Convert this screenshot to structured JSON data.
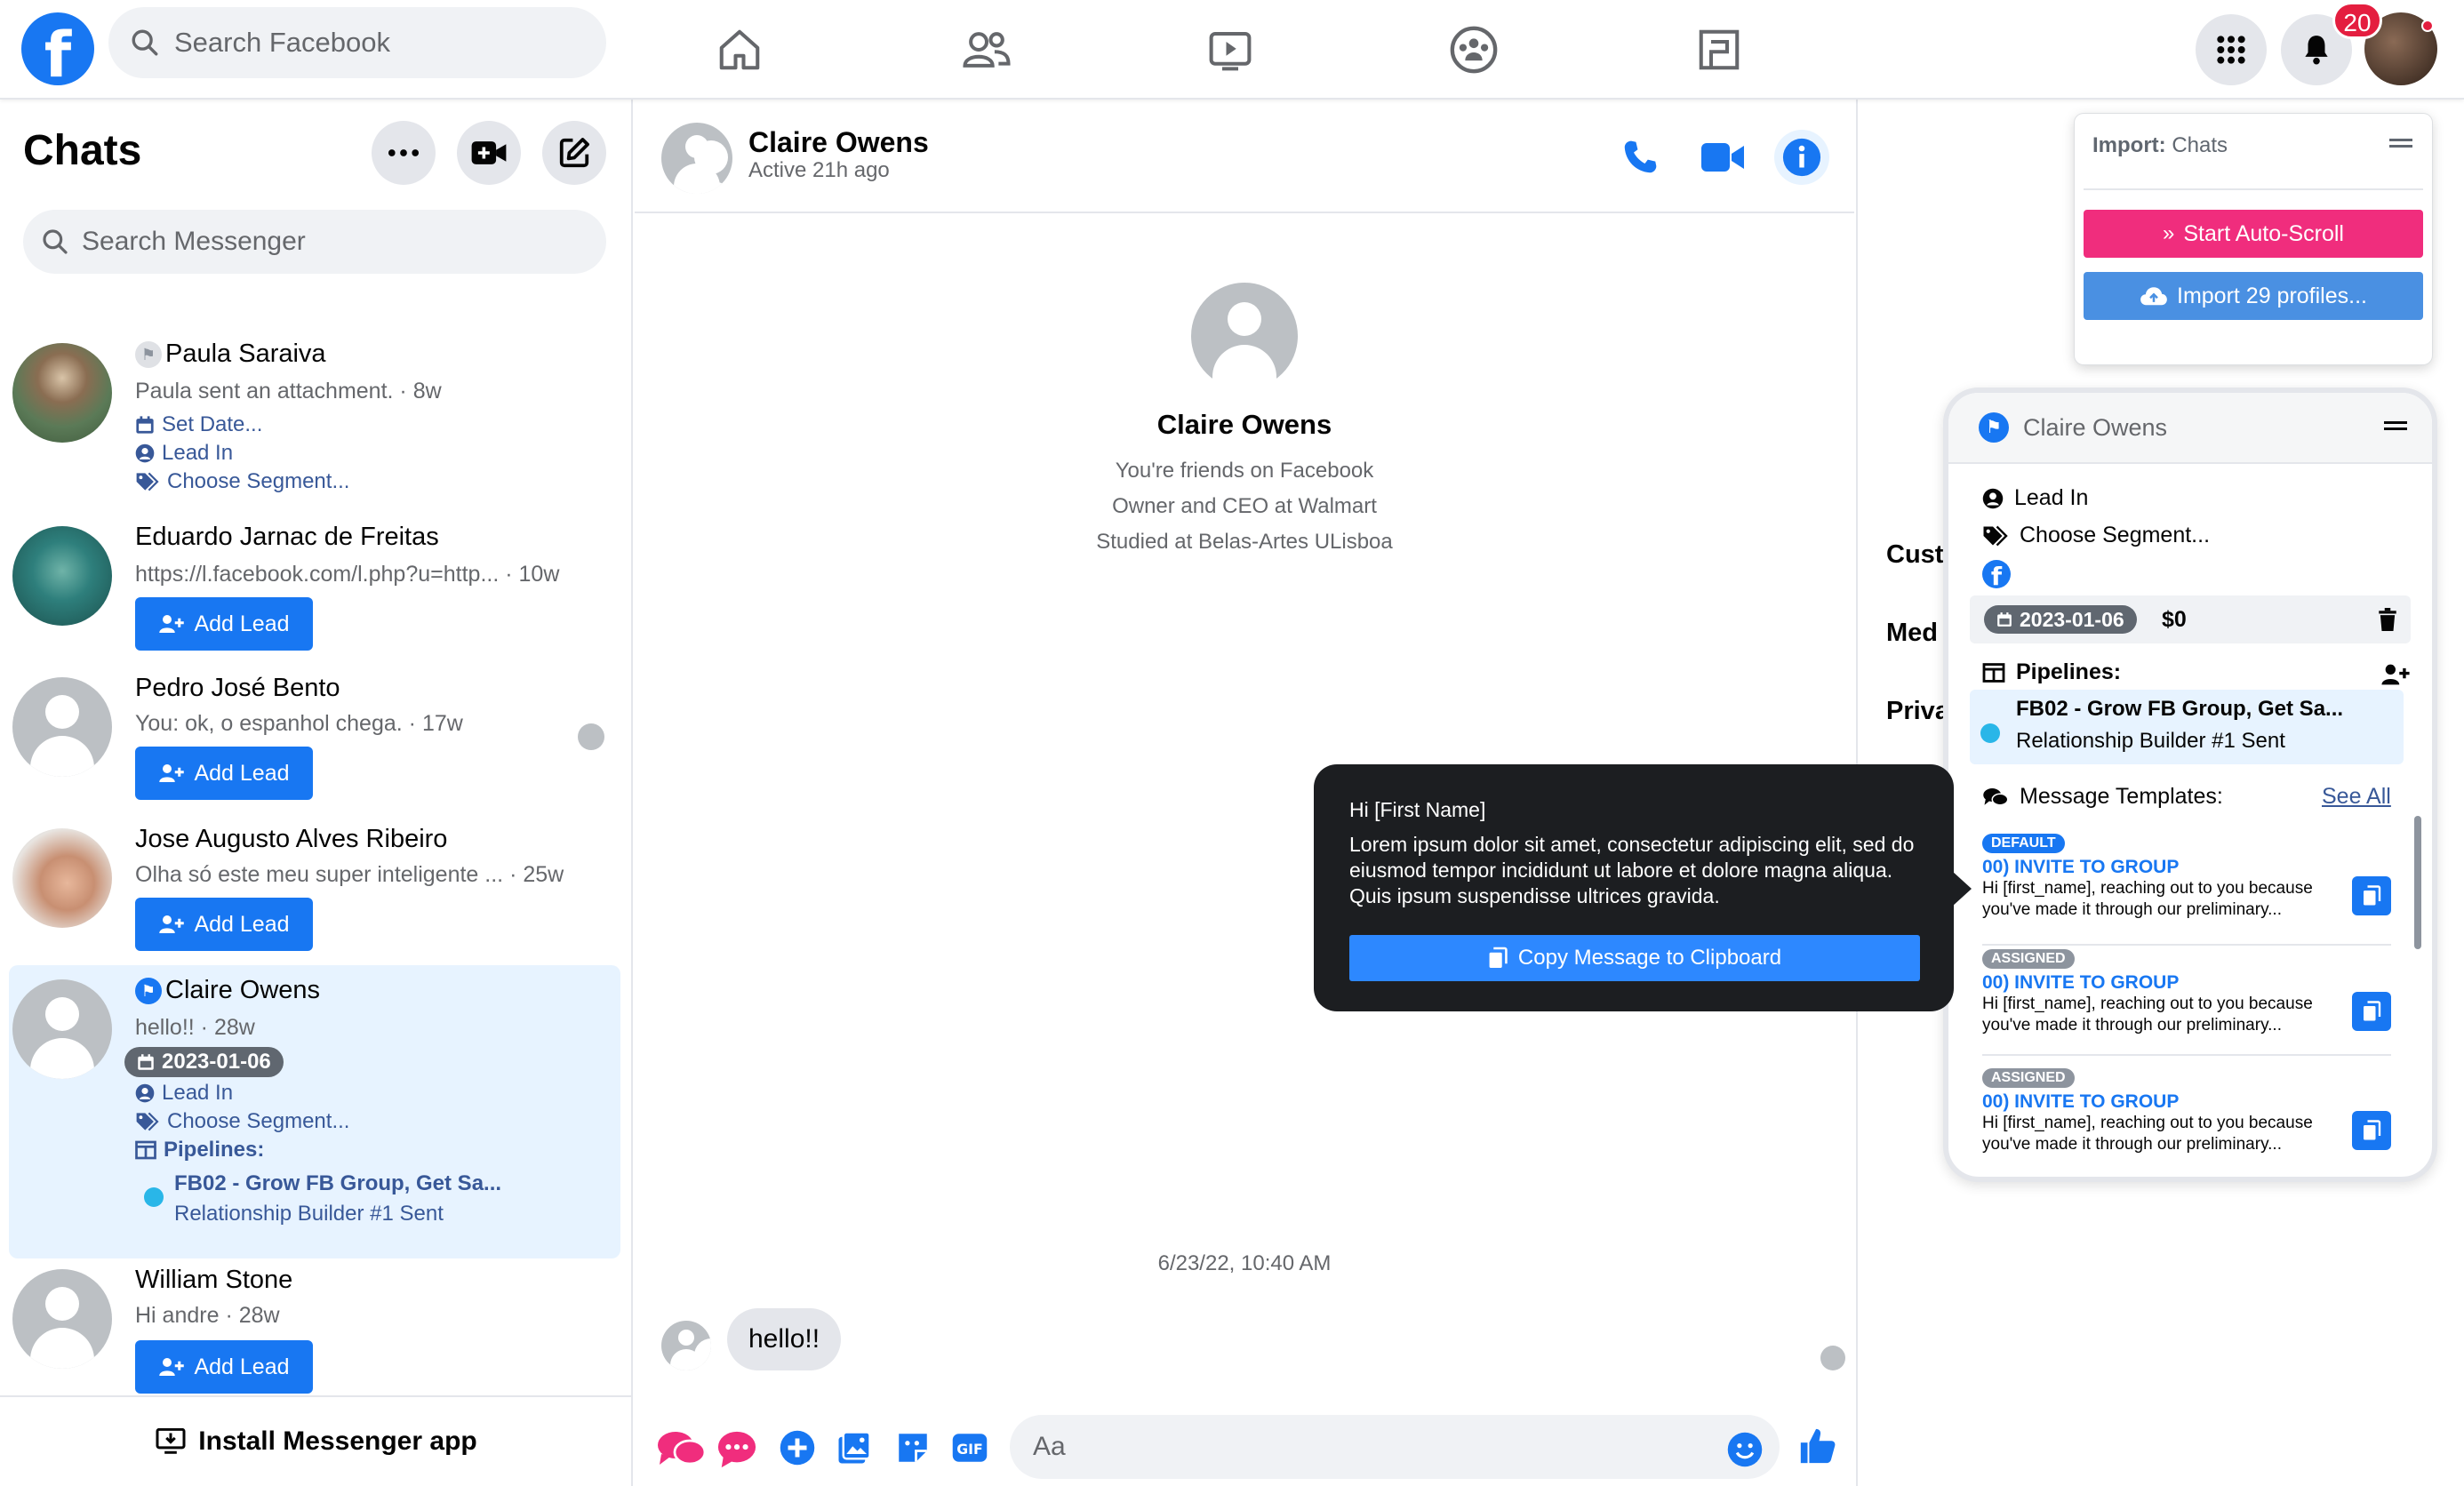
{
  "topbar": {
    "logo": "f",
    "search_placeholder": "Search Facebook",
    "notif_count": "20",
    "nav_icons": [
      "home-icon",
      "friends-icon",
      "watch-icon",
      "groups-icon",
      "gaming-icon"
    ]
  },
  "sidebar": {
    "title": "Chats",
    "search_placeholder": "Search Messenger",
    "install_label": "Install Messenger app",
    "add_lead_label": "Add Lead",
    "chats": [
      {
        "name": "Paula Saraiva",
        "preview": "Paula sent an attachment.",
        "time": "· 8w",
        "set_date": "Set Date...",
        "stage": "Lead In",
        "segment": "Choose Segment..."
      },
      {
        "name": "Eduardo Jarnac de Freitas",
        "preview": "https://l.facebook.com/l.php?u=http...",
        "time": "· 10w"
      },
      {
        "name": "Pedro José Bento",
        "preview": "You: ok, o espanhol chega.",
        "time": "· 17w"
      },
      {
        "name": "Jose Augusto Alves Ribeiro",
        "preview": "Olha só este meu super inteligente ...",
        "time": "· 25w"
      },
      {
        "name": "Claire Owens",
        "preview": "hello!!",
        "time": "· 28w",
        "date": "2023-01-06",
        "stage": "Lead In",
        "segment": "Choose Segment...",
        "pipelines_label": "Pipelines:",
        "pipeline_name": "FB02 - Grow FB Group, Get Sa...",
        "pipeline_stage": "Relationship Builder #1 Sent"
      },
      {
        "name": "William Stone",
        "preview": "Hi andre",
        "time": "· 28w"
      }
    ]
  },
  "conversation": {
    "name": "Claire Owens",
    "active": "Active 21h ago",
    "profile_name": "Claire Owens",
    "profile_lines": [
      "You're friends on Facebook",
      "Owner and CEO at Walmart",
      "Studied at Belas-Artes ULisboa"
    ],
    "timestamp": "6/23/22, 10:40 AM",
    "message": "hello!!",
    "composer_placeholder": "Aa"
  },
  "right_peek": [
    "Cust",
    "Med",
    "Priva"
  ],
  "import_panel": {
    "title_bold": "Import:",
    "title_rest": " Chats",
    "auto_scroll": "Start Auto-Scroll",
    "import_profiles": "Import 29 profiles...",
    "auto_scroll_color": "#f02d7d",
    "import_color": "#4a90e2"
  },
  "lead_panel": {
    "name": "Claire Owens",
    "stage": "Lead In",
    "segment": "Choose Segment...",
    "date": "2023-01-06",
    "amount": "$0",
    "pipelines_label": "Pipelines:",
    "pipeline_name": "FB02 - Grow FB Group, Get Sa...",
    "pipeline_stage": "Relationship Builder #1 Sent",
    "templates_label": "Message Templates:",
    "see_all": "See All",
    "templates": [
      {
        "badge": "DEFAULT",
        "title": "00) INVITE TO GROUP",
        "body": "Hi [first_name], reaching out to you because you've made it through our preliminary..."
      },
      {
        "badge": "ASSIGNED",
        "title": "00) INVITE TO GROUP",
        "body": "Hi [first_name], reaching out to you because you've made it through our preliminary..."
      },
      {
        "badge": "ASSIGNED",
        "title": "00) INVITE TO GROUP",
        "body": "Hi [first_name], reaching out to you because you've made it through our preliminary..."
      }
    ]
  },
  "tooltip": {
    "title": "Hi [First Name]",
    "body": "Lorem ipsum dolor sit amet, consectetur adipiscing elit, sed do eiusmod tempor incididunt ut labore et dolore magna aliqua. Quis ipsum suspendisse ultrices gravida.",
    "button": "Copy Message to Clipboard"
  },
  "colors": {
    "brand": "#1877f2",
    "pink": "#f02d7d",
    "pipeline_dot": "#29b6e8"
  }
}
